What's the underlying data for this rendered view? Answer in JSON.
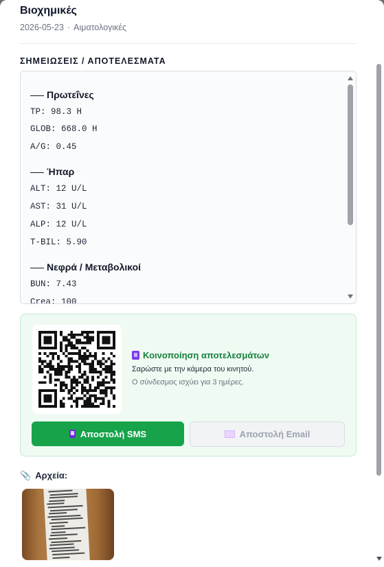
{
  "header": {
    "title": "Βιοχημικές",
    "date": "2026-05-23",
    "separator": "·",
    "category": "Αιματολογικές"
  },
  "notes": {
    "label": "ΣΗΜΕΙΩΣΕΙΣ / ΑΠΟΤΕΛΕΣΜΑΤΑ",
    "groups": [
      {
        "title": "Πρωτεΐνες",
        "lines": [
          "TP: 98.3 H",
          "GLOB: 668.0 H",
          "A/G: 0.45"
        ]
      },
      {
        "title": "Ήπαρ",
        "lines": [
          "ALT: 12 U/L",
          "AST: 31 U/L",
          "ALP: 12 U/L",
          "T-BIL: 5.90"
        ]
      },
      {
        "title": "Νεφρά / Μεταβολικοί",
        "lines": [
          "BUN: 7.43",
          "Crea: 100"
        ]
      }
    ]
  },
  "share": {
    "title": "Κοινοποίηση αποτελεσμάτων",
    "title_icon": "mobile-phone-icon",
    "line1": "Σαρώστε με την κάμερα του κινητού.",
    "line2": "Ο σύνδεσμος ισχύει για 3 ημέρες.",
    "sms_label": "Αποστολή SMS",
    "email_label": "Αποστολή Email",
    "accent": "#16a34a"
  },
  "files": {
    "label": "Αρχεία:",
    "icon": "paperclip-icon"
  }
}
